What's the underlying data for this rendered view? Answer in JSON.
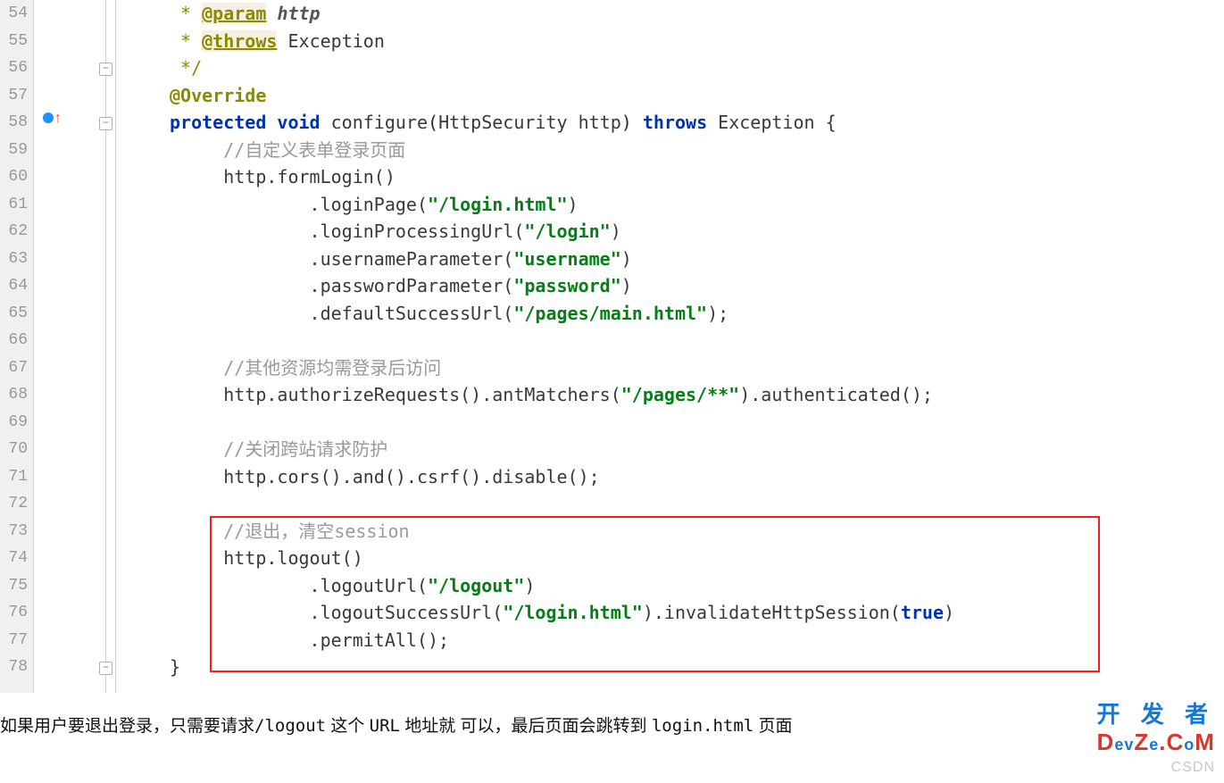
{
  "lines": [
    "54",
    "55",
    "56",
    "57",
    "58",
    "59",
    "60",
    "61",
    "62",
    "63",
    "64",
    "65",
    "66",
    "67",
    "68",
    "69",
    "70",
    "71",
    "72",
    "73",
    "74",
    "75",
    "76",
    "77",
    "78"
  ],
  "tokens": {
    "param_tag": "@param",
    "param_name": "http",
    "throws_tag": "@throws",
    "exc_doc": "Exception",
    "override": "@Override",
    "protected": "protected",
    "void": "void",
    "configure": "configure",
    "httpsec": "HttpSecurity",
    "http_arg": "http",
    "throws_kw": "throws",
    "exc": "Exception",
    "brace_open": "{",
    "brace_close": "}",
    "c_formlogin": "自定义表单登录页面",
    "http1": "http.formLogin()",
    "call_loginPage": ".loginPage(",
    "s_loginhtml": "\"/login.html\"",
    "close_paren": ")",
    "call_loginProc": ".loginProcessingUrl(",
    "s_login": "\"/login\"",
    "call_userParam": ".usernameParameter(",
    "s_username": "\"username\"",
    "call_passParam": ".passwordParameter(",
    "s_password": "\"password\"",
    "call_defSuccess": ".defaultSuccessUrl(",
    "s_mainhtml": "\"/pages/main.html\"",
    "semi": ";",
    "c_other": "其他资源均需登录后访问",
    "antMatchers_pre": "http.authorizeRequests().antMatchers(",
    "s_pages": "\"/pages/**\"",
    "antMatchers_post": ").authenticated();",
    "c_csrf": "关闭跨站请求防护",
    "cors_line": "http.cors().and().csrf().disable();",
    "c_logout_pre": "退出，清空",
    "c_logout_session": "session",
    "http_logout": "http.logout()",
    "call_logoutUrl": ".logoutUrl(",
    "s_logout": "\"/logout\"",
    "call_logoutSuccess": ".logoutSuccessUrl(",
    "s_loginhtml2": "\"/login.html\"",
    "invalidate_pre": ").invalidateHttpSession(",
    "true": "true",
    "invalidate_post": ")",
    "permitAll": ".permitAll();"
  },
  "article": {
    "pre": "如果用户要退出登录，只需要请求",
    "logout": "/logout",
    "mid1": " 这个 ",
    "url": "URL",
    "mid2": " 地址就  可以，最后页面会跳转到 ",
    "login": "login.html",
    "post": " 页面"
  },
  "watermark": {
    "line1_a": "开 发 者",
    "devze_d": "D",
    "devze_e1": "e",
    "devze_v": "v",
    "devze_z": "Z",
    "devze_e2": "e",
    "devze_dot": ".",
    "devze_c": "C",
    "devze_o": "o",
    "devze_m": "M",
    "line2_pre": "CSDN ",
    "line2_post": ""
  }
}
